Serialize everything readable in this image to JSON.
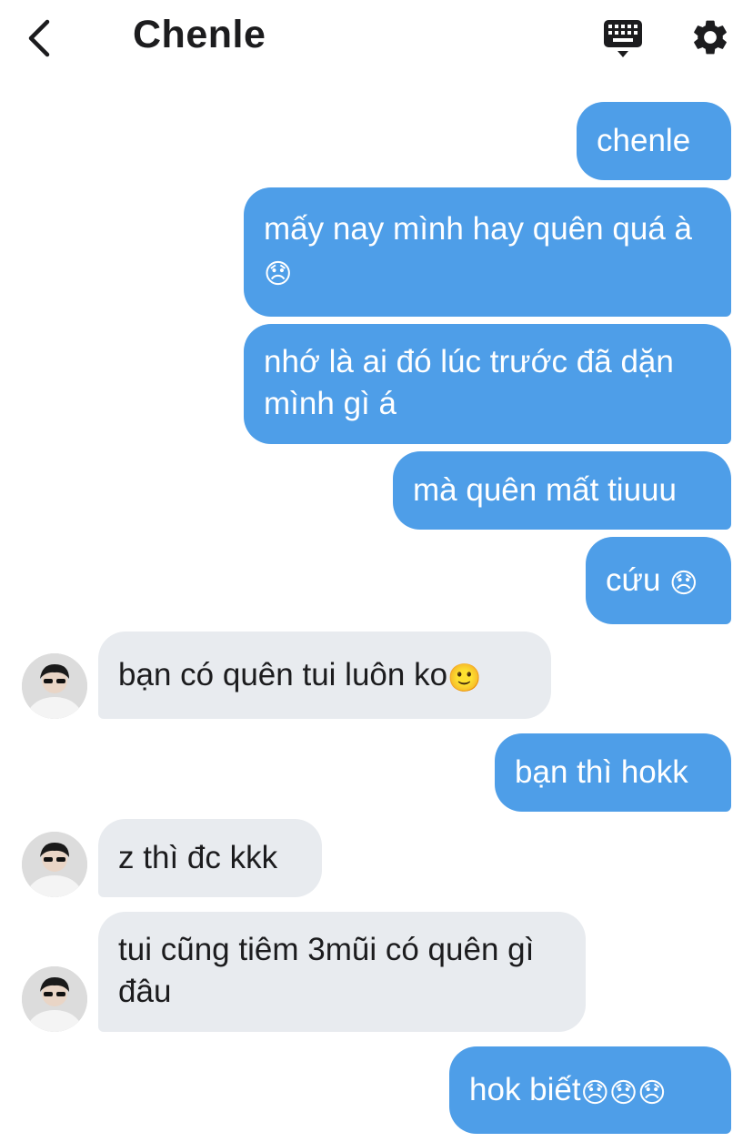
{
  "header": {
    "title": "Chenle",
    "back_icon": "chevron-left-icon",
    "keyboard_icon": "keyboard-icon",
    "settings_icon": "gear-icon"
  },
  "colors": {
    "outgoing_bubble": "#4e9ee8",
    "incoming_bubble": "#e8ebef",
    "text_dark": "#1c1c1e"
  },
  "messages": [
    {
      "from": "me",
      "text": "chenle"
    },
    {
      "from": "me",
      "text": "mấy nay mình hay quên quá à😞"
    },
    {
      "from": "me",
      "text": "nhớ là ai đó lúc trước đã dặn mình gì á"
    },
    {
      "from": "me",
      "text": "mà quên mất tiuuu"
    },
    {
      "from": "me",
      "text": "cứu 😞"
    },
    {
      "from": "them",
      "text": "bạn có quên tui luôn ko🙂"
    },
    {
      "from": "me",
      "text": "bạn thì hokk"
    },
    {
      "from": "them",
      "text": "z thì đc kkk"
    },
    {
      "from": "them",
      "text": "tui cũng tiêm 3mũi có quên gì đâu"
    },
    {
      "from": "me",
      "text": "hok biết😞😞😞"
    }
  ]
}
